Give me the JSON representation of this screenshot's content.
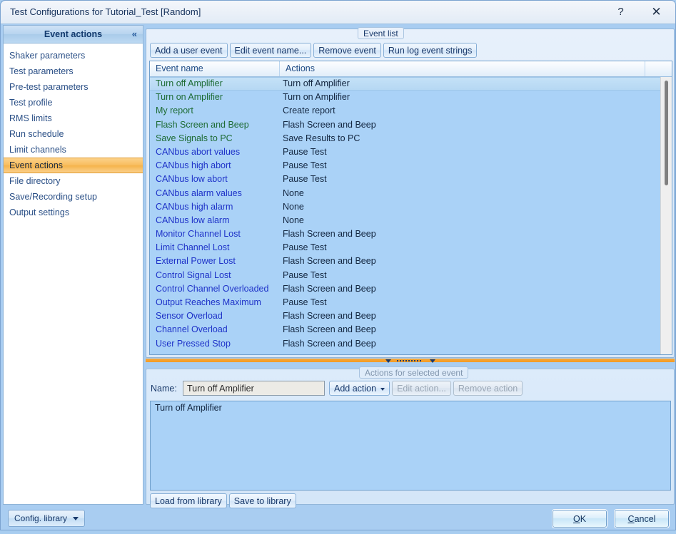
{
  "window": {
    "title": "Test Configurations for Tutorial_Test [Random]",
    "help_icon": "?",
    "close_icon": "✕"
  },
  "sidebar": {
    "header": "Event actions",
    "collapse_icon": "«",
    "items": [
      {
        "label": "Shaker parameters"
      },
      {
        "label": "Test parameters"
      },
      {
        "label": "Pre-test parameters"
      },
      {
        "label": "Test profile"
      },
      {
        "label": "RMS limits"
      },
      {
        "label": "Run schedule"
      },
      {
        "label": "Limit channels"
      },
      {
        "label": "Event actions"
      },
      {
        "label": "File directory"
      },
      {
        "label": "Save/Recording setup"
      },
      {
        "label": "Output settings"
      }
    ],
    "selected_index": 7,
    "config_library": "Config. library"
  },
  "event_list": {
    "legend": "Event list",
    "toolbar": [
      {
        "label": "Add a user event"
      },
      {
        "label": "Edit event name..."
      },
      {
        "label": "Remove event"
      },
      {
        "label": "Run log event strings"
      }
    ],
    "columns": [
      "Event name",
      "Actions",
      ""
    ],
    "selected_index": 0,
    "rows": [
      {
        "name": "Turn off Amplifier",
        "action": "Turn off Amplifier",
        "tone": "green"
      },
      {
        "name": "Turn on Amplifier",
        "action": "Turn on Amplifier",
        "tone": "green"
      },
      {
        "name": "My report",
        "action": "Create report",
        "tone": "green"
      },
      {
        "name": "Flash Screen and Beep",
        "action": "Flash Screen and Beep",
        "tone": "green"
      },
      {
        "name": "Save Signals to PC",
        "action": "Save Results to PC",
        "tone": "green"
      },
      {
        "name": "CANbus abort values",
        "action": "Pause Test",
        "tone": "blue"
      },
      {
        "name": "CANbus high abort",
        "action": "Pause Test",
        "tone": "blue"
      },
      {
        "name": "CANbus low abort",
        "action": "Pause Test",
        "tone": "blue"
      },
      {
        "name": "CANbus alarm values",
        "action": "None",
        "tone": "blue"
      },
      {
        "name": "CANbus high alarm",
        "action": "None",
        "tone": "blue"
      },
      {
        "name": "CANbus low alarm",
        "action": "None",
        "tone": "blue"
      },
      {
        "name": "Monitor Channel Lost",
        "action": "Flash Screen and Beep",
        "tone": "blue"
      },
      {
        "name": "Limit Channel Lost",
        "action": "Pause Test",
        "tone": "blue"
      },
      {
        "name": "External Power Lost",
        "action": "Flash Screen and Beep",
        "tone": "blue"
      },
      {
        "name": "Control Signal Lost",
        "action": "Pause Test",
        "tone": "blue"
      },
      {
        "name": "Control Channel Overloaded",
        "action": "Flash Screen and Beep",
        "tone": "blue"
      },
      {
        "name": "Output Reaches Maximum",
        "action": "Pause Test",
        "tone": "blue"
      },
      {
        "name": "Sensor Overload",
        "action": "Flash Screen and Beep",
        "tone": "blue"
      },
      {
        "name": "Channel Overload",
        "action": "Flash Screen and Beep",
        "tone": "blue"
      },
      {
        "name": "User Pressed Stop",
        "action": "Flash Screen and Beep",
        "tone": "blue"
      }
    ]
  },
  "actions_panel": {
    "legend": "Actions for selected event",
    "name_label": "Name:",
    "name_value": "Turn off Amplifier",
    "name_placeholder": "",
    "buttons": [
      {
        "label": "Add action",
        "disabled": false
      },
      {
        "label": "Edit action...",
        "disabled": true
      },
      {
        "label": "Remove action",
        "disabled": true
      }
    ],
    "action_items": [
      "Turn off Amplifier"
    ],
    "library_buttons": [
      {
        "label": "Load from library"
      },
      {
        "label": "Save to library"
      }
    ]
  },
  "footer": {
    "ok": "OK",
    "ok_accel": "O",
    "cancel": "Cancel",
    "cancel_accel": "C"
  },
  "colors": {
    "accent_selected_nav": "#f5b44b",
    "splitter": "#f49a23",
    "list_background": "#aad2f7",
    "event_green": "#1d6b34",
    "event_blue": "#1e32c8"
  }
}
